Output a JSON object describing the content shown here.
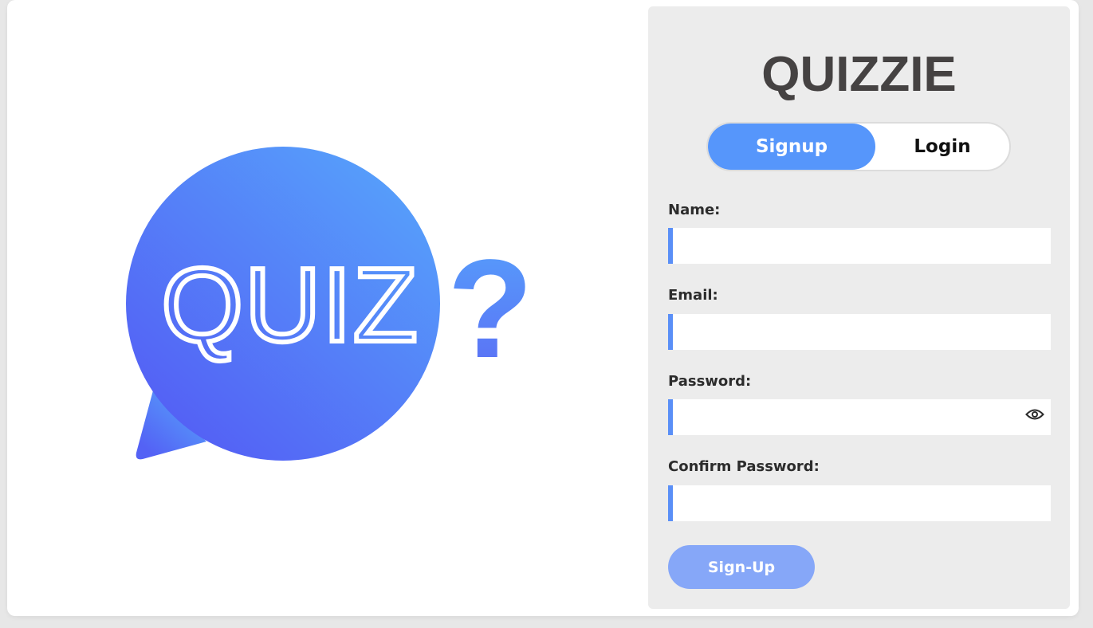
{
  "logo": {
    "bubble_text": "QUIZ",
    "mark": "?"
  },
  "header": {
    "title": "QUIZZIE"
  },
  "toggle": {
    "signup_label": "Signup",
    "login_label": "Login",
    "active": "Signup"
  },
  "form": {
    "name": {
      "label": "Name:",
      "value": ""
    },
    "email": {
      "label": "Email:",
      "value": ""
    },
    "password": {
      "label": "Password:",
      "value": ""
    },
    "confirm_password": {
      "label": "Confirm Password:",
      "value": ""
    },
    "submit_label": "Sign-Up"
  },
  "icons": {
    "password_toggle": "eye-icon"
  },
  "colors": {
    "accent": "#5696fb",
    "input_bar": "#5a8ff7",
    "submit": "#86a7f8",
    "title": "#454242",
    "panel": "#ececec"
  }
}
